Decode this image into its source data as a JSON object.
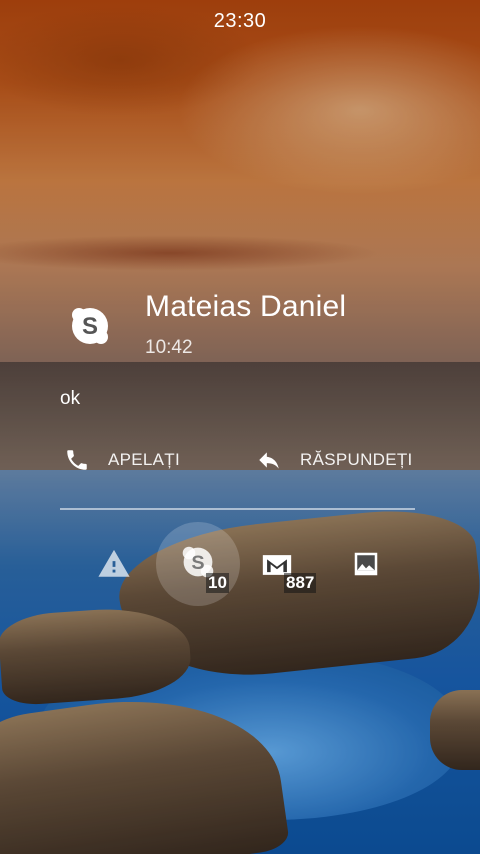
{
  "status_bar": {
    "clock": "23:30"
  },
  "notification": {
    "app_icon": "skype-icon",
    "title": "Mateias Daniel",
    "time": "10:42",
    "message": "ok"
  },
  "actions": {
    "call": {
      "label": "APELAȚI",
      "icon": "phone-icon"
    },
    "reply": {
      "label": "RĂSPUNDEȚI",
      "icon": "reply-icon"
    }
  },
  "app_tray": [
    {
      "name": "warning",
      "icon": "warning-icon",
      "badge": ""
    },
    {
      "name": "skype",
      "icon": "skype-icon",
      "badge": "10"
    },
    {
      "name": "gmail",
      "icon": "gmail-icon",
      "badge": "887"
    },
    {
      "name": "gallery",
      "icon": "image-icon",
      "badge": ""
    }
  ],
  "colors": {
    "sky_orange": "#c35a1c",
    "water_blue": "#1a63b8",
    "text": "#ffffff"
  }
}
